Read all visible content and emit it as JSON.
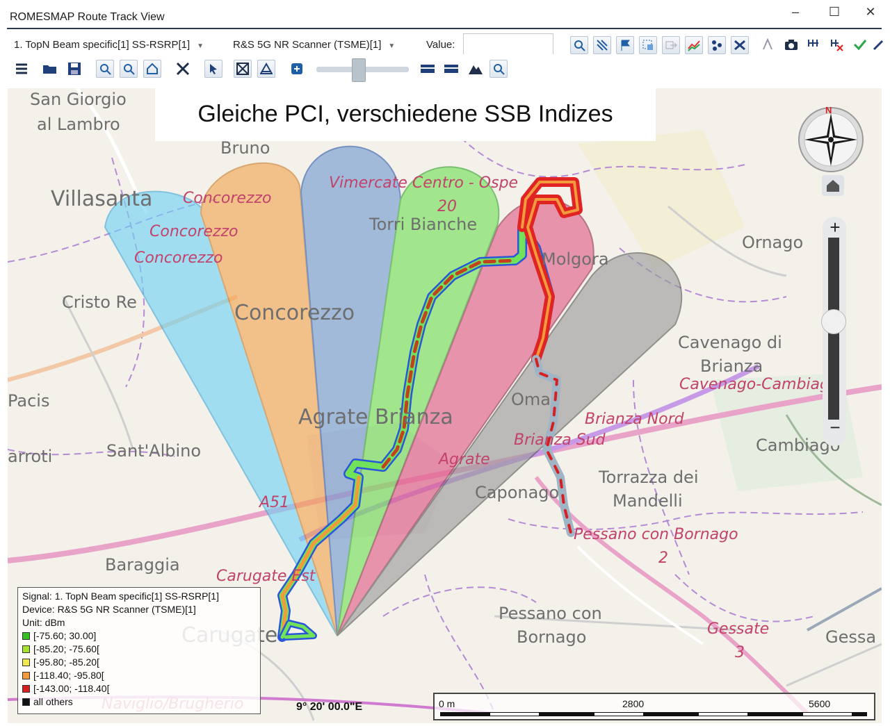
{
  "window": {
    "title": "ROMESMAP Route Track View",
    "minimize": "–",
    "maximize": "☐",
    "close": "✕"
  },
  "toolbar": {
    "signal_select": "1. TopN Beam specific[1] SS-RSRP[1]",
    "device_select": "R&S 5G NR Scanner (TSME)[1]",
    "value_label": "Value:",
    "value": "",
    "icons_row1": [
      "find-icon",
      "route-icon",
      "flag-icon",
      "select-area-icon",
      "export-icon",
      "chart-icon",
      "dots-icon",
      "swap-icon",
      "measure-icon",
      "camera-icon",
      "grid-icon",
      "grid-delete-icon",
      "check-icon",
      "pen-icon"
    ],
    "icons_row2": [
      "list-icon",
      "open-folder-icon",
      "save-icon",
      "zoom-in-icon",
      "zoom-out-icon",
      "home-icon",
      "fit-icon",
      "pointer-icon",
      "cross-box-icon",
      "triangle-icon",
      "layers-icon",
      "map-strip-icon",
      "map-strip2-icon",
      "mountain-icon",
      "search-map-icon"
    ],
    "slider_position": 0.45
  },
  "map": {
    "headline": "Gleiche PCI, verschiedene SSB Indizes",
    "labels": [
      {
        "text": "San Giorgio",
        "cls": "town"
      },
      {
        "text": "al Lambro",
        "cls": "town"
      },
      {
        "text": "Bruno",
        "cls": "town"
      },
      {
        "text": "Villasanta",
        "cls": "big"
      },
      {
        "text": "Concorezzo",
        "cls": "stn"
      },
      {
        "text": "Concorezzo",
        "cls": "stn"
      },
      {
        "text": "Concorezzo",
        "cls": "stn"
      },
      {
        "text": "Vimercate Centro - Ospe",
        "cls": "stn"
      },
      {
        "text": "20",
        "cls": "stn"
      },
      {
        "text": "Torri Bianche",
        "cls": "town"
      },
      {
        "text": "Ornago",
        "cls": "town"
      },
      {
        "text": "Molgora",
        "cls": "town"
      },
      {
        "text": "Cristo Re",
        "cls": "town"
      },
      {
        "text": "Concorezzo",
        "cls": "big"
      },
      {
        "text": "Cavenago di",
        "cls": "town"
      },
      {
        "text": "Brianza",
        "cls": "town"
      },
      {
        "text": "Cavenago-Cambiago",
        "cls": "stn"
      },
      {
        "text": "Pacis",
        "cls": "town"
      },
      {
        "text": "Agrate Brianza",
        "cls": "big"
      },
      {
        "text": "Oma",
        "cls": "town"
      },
      {
        "text": "Brianza Nord",
        "cls": "stn"
      },
      {
        "text": "Brianza Sud",
        "cls": "stn"
      },
      {
        "text": "Cambiago",
        "cls": "town"
      },
      {
        "text": "arroti",
        "cls": "town"
      },
      {
        "text": "Sant'Albino",
        "cls": "town"
      },
      {
        "text": "Agrate",
        "cls": "stn"
      },
      {
        "text": "Torrazza dei",
        "cls": "town"
      },
      {
        "text": "Mandelli",
        "cls": "town"
      },
      {
        "text": "Caponago",
        "cls": "town"
      },
      {
        "text": "A51",
        "cls": "stn"
      },
      {
        "text": "Pessano con Bornago",
        "cls": "stn"
      },
      {
        "text": "2",
        "cls": "stn"
      },
      {
        "text": "Baraggia",
        "cls": "town"
      },
      {
        "text": "Carugate Est",
        "cls": "stn"
      },
      {
        "text": "Pessano con",
        "cls": "town"
      },
      {
        "text": "Bornago",
        "cls": "town"
      },
      {
        "text": "Carugate",
        "cls": "big"
      },
      {
        "text": "Gessate",
        "cls": "stn"
      },
      {
        "text": "3",
        "cls": "stn"
      },
      {
        "text": "Gessa",
        "cls": "town"
      },
      {
        "text": "Naviglio/Brugherio",
        "cls": "stn"
      }
    ],
    "compass_north": "N",
    "zoom_in": "+",
    "zoom_out": "−",
    "coordinate": "9° 20' 00.0\"E",
    "scale": {
      "start": "0 m",
      "mid": "2800",
      "end": "5600"
    }
  },
  "legend": {
    "signal": "Signal: 1. TopN Beam specific[1] SS-RSRP[1]",
    "device": "Device: R&S 5G NR Scanner (TSME)[1]",
    "unit": "Unit: dBm",
    "ranges": [
      {
        "label": "[-75.60; 30.00]",
        "color": "#34c11e"
      },
      {
        "label": "[-85.20; -75.60[",
        "color": "#a6e22e"
      },
      {
        "label": "[-95.80; -85.20[",
        "color": "#f2e94e"
      },
      {
        "label": "[-118.40; -95.80[",
        "color": "#f39a3c"
      },
      {
        "label": "[-143.00; -118.40[",
        "color": "#d62020"
      },
      {
        "label": "all others",
        "color": "#111111"
      }
    ]
  },
  "beams": [
    {
      "name": "beam-1",
      "color": "#6fd2f5"
    },
    {
      "name": "beam-2",
      "color": "#f2a451"
    },
    {
      "name": "beam-3",
      "color": "#6f99cf"
    },
    {
      "name": "beam-4",
      "color": "#6fe054"
    },
    {
      "name": "beam-5",
      "color": "#e05a86"
    },
    {
      "name": "beam-6",
      "color": "#9a9a9a"
    }
  ]
}
